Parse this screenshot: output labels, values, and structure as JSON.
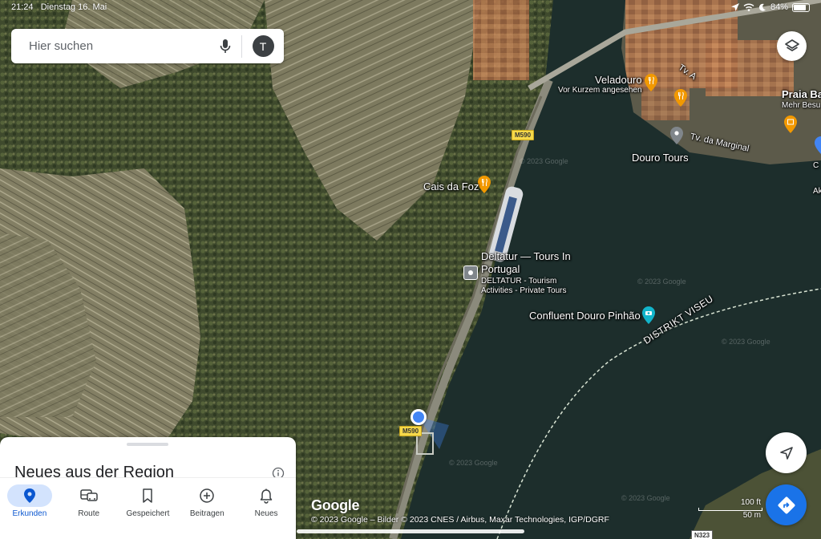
{
  "status_bar": {
    "time": "21:24",
    "date": "Dienstag 16. Mai",
    "battery_percent": "84%",
    "battery_level": 0.84
  },
  "search": {
    "placeholder": "Hier suchen",
    "avatar_initial": "T",
    "mic_icon": "microphone-icon"
  },
  "map": {
    "labels": {
      "veladouro": "Veladouro",
      "veladouro_sub": "Vor Kurzem angesehen",
      "praia": "Praia Ba",
      "praia_sub": "Mehr Besu",
      "douro_tours": "Douro Tours",
      "tv_marginal": "Tv. da Marginal",
      "tv_a": "Tv. A",
      "cais_da_foz": "Cais da Foz",
      "deltatur_1": "Deltatur — Tours In",
      "deltatur_2": "Portugal",
      "deltatur_sub1": "DELTATUR - Tourism",
      "deltatur_sub2": "Activities - Private Tours",
      "confluent": "Confluent Douro Pinhão",
      "distrikt": "DISTRIKT VISEU",
      "edge_c": "C",
      "edge_ak": "Ak"
    },
    "road_shields": {
      "m590_top": "M590",
      "m590_bottom": "M590",
      "n323": "N323"
    },
    "watermark": "© 2023 Google",
    "colors": {
      "water": "#1d2e2c",
      "location_dot": "#4285f4",
      "poi_orange": "#f29900",
      "poi_teal": "#12b5cb",
      "poi_gray": "#80868b",
      "district_line": "#d9e4d4"
    }
  },
  "controls": {
    "layers_icon": "layers-icon",
    "compass_icon": "navigation-arrow-icon",
    "directions_icon": "directions-icon"
  },
  "attribution": {
    "logo": "Google",
    "text": "© 2023 Google – Bilder © 2023 CNES / Airbus, Maxar Technologies, IGP/DGRF"
  },
  "scale": {
    "imperial": "100 ft",
    "metric": "50 m"
  },
  "sheet": {
    "title": "Neues aus der Region",
    "info_icon": "info-icon"
  },
  "tabs": [
    {
      "label": "Erkunden",
      "icon": "location-pin-icon",
      "active": true
    },
    {
      "label": "Route",
      "icon": "commute-icon",
      "active": false
    },
    {
      "label": "Gespeichert",
      "icon": "bookmark-icon",
      "active": false
    },
    {
      "label": "Beitragen",
      "icon": "add-circle-icon",
      "active": false
    },
    {
      "label": "Neues",
      "icon": "bell-icon",
      "active": false
    }
  ]
}
